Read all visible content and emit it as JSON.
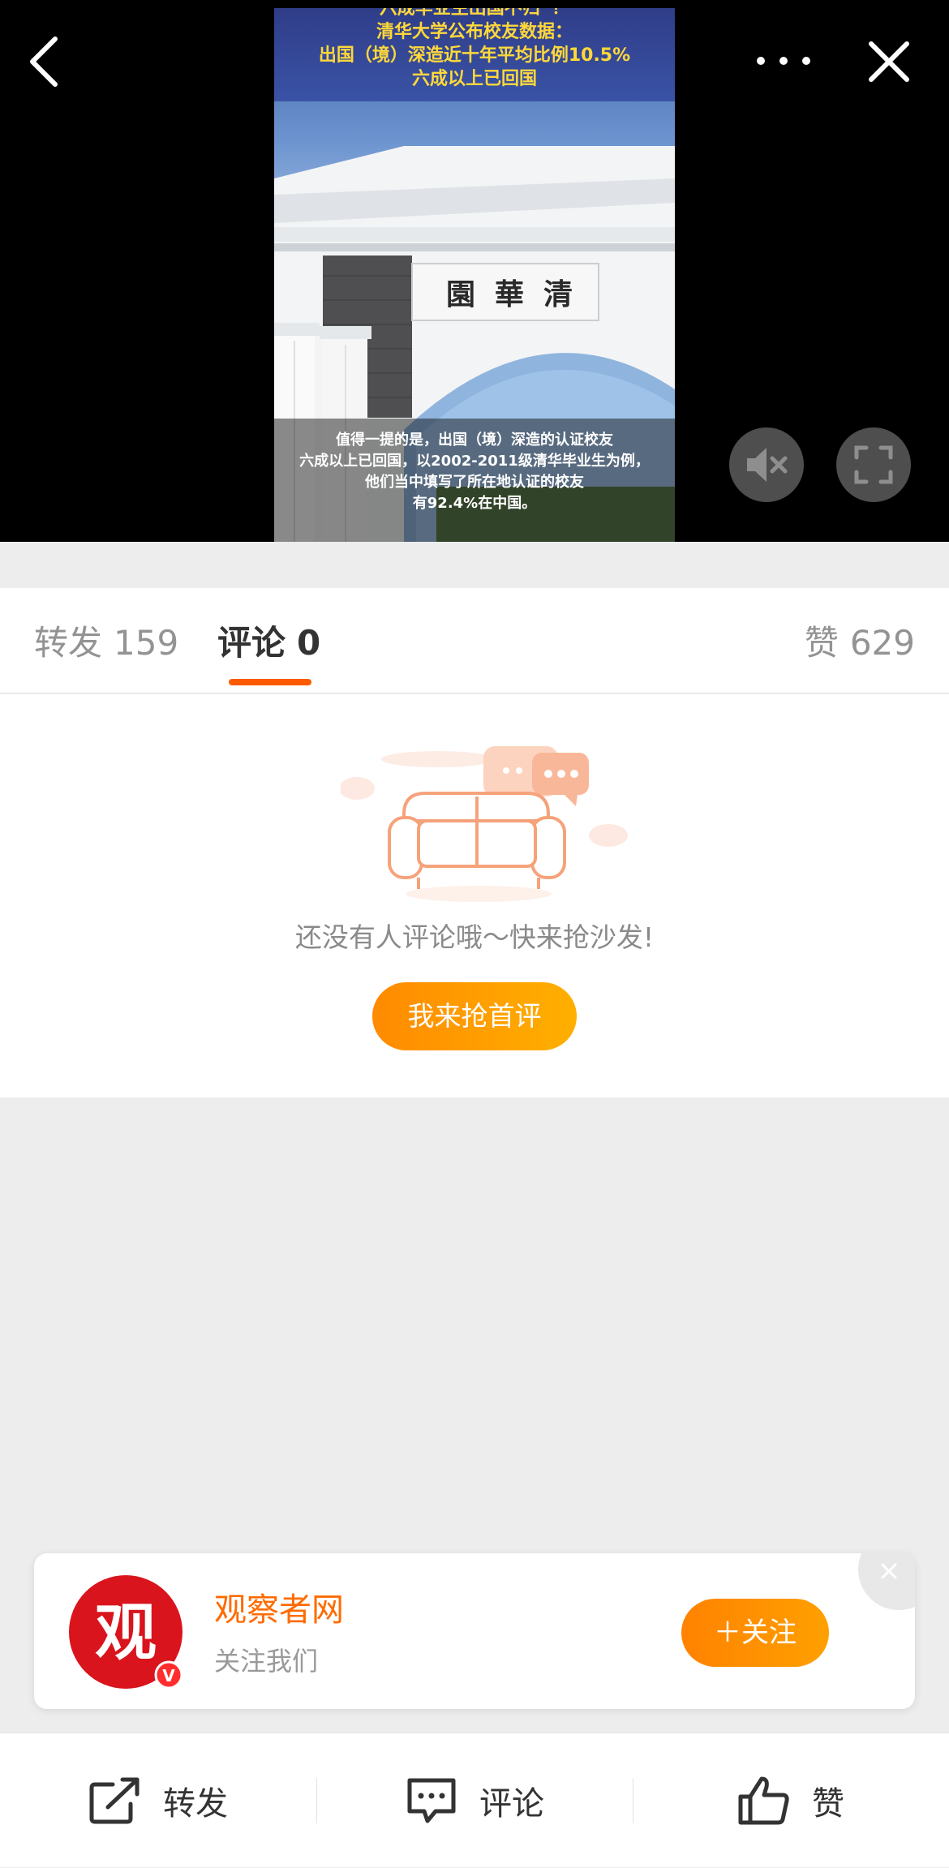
{
  "video": {
    "caption_top": [
      "六成毕业生出国不归“？",
      "清华大学公布校友数据：",
      "出国（境）深造近十年平均比例10.5%",
      "六成以上已回国"
    ],
    "gate_characters": [
      "清",
      "華",
      "園"
    ],
    "caption_bottom": [
      "值得一提的是，出国（境）深造的认证校友",
      "六成以上已回国，以2002-2011级清华毕业生为例，",
      "他们当中填写了所在地认证的校友",
      "有92.4%在中国。"
    ],
    "icons": {
      "back": "back-arrow-icon",
      "more": "more-dots-icon",
      "close": "close-icon",
      "mute": "mute-icon",
      "fullscreen": "fullscreen-icon"
    }
  },
  "tabs": {
    "repost": {
      "label": "转发",
      "count": "159"
    },
    "comment": {
      "label": "评论",
      "count": "0"
    },
    "like": {
      "label": "赞",
      "count": "629"
    },
    "active": "comment",
    "accent_color": "#ff5a00"
  },
  "empty": {
    "message": "还没有人评论哦～快来抢沙发!",
    "button": "我来抢首评",
    "icon": "sofa-illustration"
  },
  "follow_card": {
    "avatar_text": "观",
    "name": "观察者网",
    "subtitle": "关注我们",
    "button": "＋关注",
    "verified_badge": "V",
    "brand_color": "#ff6b00"
  },
  "bottom_bar": {
    "repost": "转发",
    "comment": "评论",
    "like": "赞"
  }
}
